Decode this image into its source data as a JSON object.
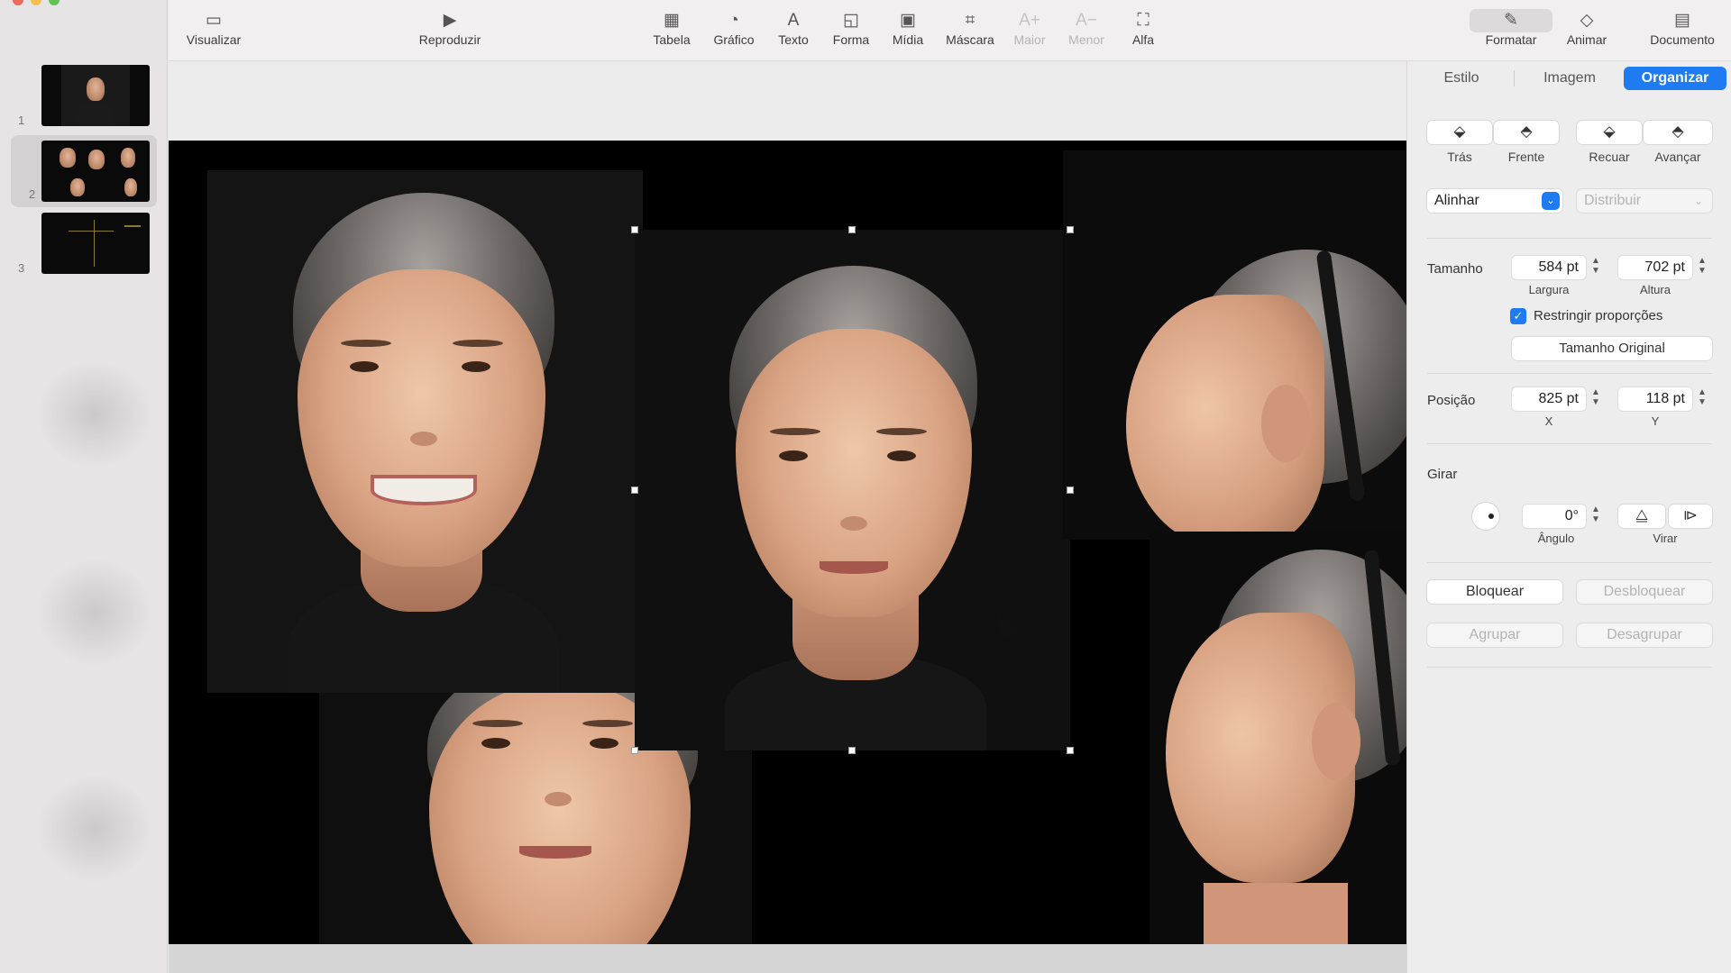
{
  "toolbar": {
    "visualizar": "Visualizar",
    "reproduzir": "Reproduzir",
    "tabela": "Tabela",
    "grafico": "Gráfico",
    "texto": "Texto",
    "forma": "Forma",
    "midia": "Mídia",
    "mascara": "Máscara",
    "maior": "Maior",
    "menor": "Menor",
    "alfa": "Alfa",
    "formatar": "Formatar",
    "animar": "Animar",
    "documento": "Documento"
  },
  "icons": {
    "sidebar": "▭",
    "play": "▶",
    "table": "▦",
    "chart": "◔",
    "text": "A",
    "shape": "◱",
    "media": "▣",
    "mask": "⌗",
    "bigger": "A+",
    "smaller": "A−",
    "alpha": "⛶",
    "format": "✎",
    "animate": "◇",
    "document": "▤"
  },
  "slides": [
    {
      "number": "1"
    },
    {
      "number": "2"
    },
    {
      "number": "3"
    }
  ],
  "inspector": {
    "tabs": {
      "estilo": "Estilo",
      "imagem": "Imagem",
      "organizar": "Organizar"
    },
    "arrange": {
      "tras": "Trás",
      "frente": "Frente",
      "recuar": "Recuar",
      "avancar": "Avançar"
    },
    "alinhar": "Alinhar",
    "distribuir": "Distribuir",
    "size": {
      "label": "Tamanho",
      "width": "584 pt",
      "height": "702 pt",
      "width_label": "Largura",
      "height_label": "Altura"
    },
    "constrain_label": "Restringir proporções",
    "original_size": "Tamanho Original",
    "position": {
      "label": "Posição",
      "x": "825 pt",
      "y": "118 pt",
      "x_label": "X",
      "y_label": "Y"
    },
    "rotate": {
      "label": "Girar",
      "angle": "0°",
      "angle_label": "Ângulo",
      "flip_label": "Virar"
    },
    "lock": "Bloquear",
    "unlock": "Desbloquear",
    "group": "Agrupar",
    "ungroup": "Desagrupar"
  },
  "colors": {
    "accent": "#1e7bf2",
    "slide_background": "#000000"
  }
}
